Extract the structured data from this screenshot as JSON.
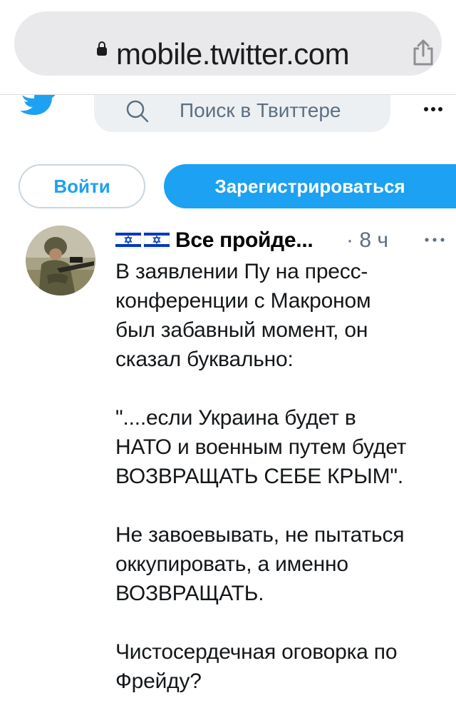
{
  "browser": {
    "url": "mobile.twitter.com",
    "lock_icon": "lock-icon",
    "share_icon": "share-icon"
  },
  "twitter_header": {
    "logo_icon": "twitter-bird-icon",
    "search_placeholder": "Поиск в Твиттере",
    "more_icon": "more-horizontal-icon"
  },
  "auth": {
    "login_label": "Войти",
    "signup_label": "Зарегистрироваться"
  },
  "tweet": {
    "author_name": "Все пройде...",
    "author_flags": [
      "israel-flag",
      "israel-flag"
    ],
    "time": "· 8 ч",
    "text_lines": [
      "В заявлении Пу на пресс-",
      "конференции с Макроном",
      "был забавный момент, он",
      "сказал буквально:",
      "",
      "\"....если Украина будет в",
      "НАТО и военным путем будет",
      "ВОЗВРАЩАТЬ СЕБЕ КРЫМ\".",
      "",
      "Не завоевывать, не пытаться",
      "оккупировать, а именно",
      "ВОЗВРАЩАТЬ.",
      "",
      " Чистосердечная оговорка по",
      "Фрейду?"
    ]
  },
  "colors": {
    "twitter_blue": "#1da1f2",
    "secondary_text": "#5b7083",
    "url_bar_bg": "#e9e9eb"
  }
}
